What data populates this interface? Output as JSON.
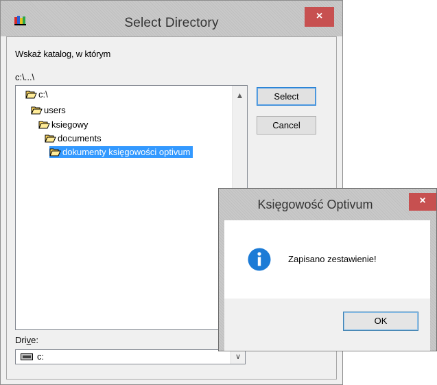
{
  "select_dialog": {
    "title": "Select Directory",
    "close_label": "×",
    "prompt": "Wskaż katalog, w którym",
    "current_path": "c:\\...\\",
    "tree": [
      {
        "label": "c:\\",
        "depth": 0,
        "selected": false,
        "icon": "open-folder-icon"
      },
      {
        "label": "users",
        "depth": 1,
        "selected": false,
        "icon": "open-folder-icon"
      },
      {
        "label": "ksiegowy",
        "depth": 2,
        "selected": false,
        "icon": "open-folder-icon"
      },
      {
        "label": "documents",
        "depth": 3,
        "selected": false,
        "icon": "open-folder-icon"
      },
      {
        "label": "dokumenty księgowości optivum",
        "depth": 4,
        "selected": true,
        "icon": "open-folder-icon"
      }
    ],
    "select_button": "Select",
    "cancel_button": "Cancel",
    "drive_label_underlined": "v",
    "drive_label_prefix": "Dri",
    "drive_label_suffix": "e:",
    "drive_value": "c:"
  },
  "message_box": {
    "title": "Księgowość Optivum",
    "close_label": "×",
    "message": "Zapisano zestawienie!",
    "ok_button": "OK",
    "icon": "info-icon"
  },
  "colors": {
    "selection": "#3399ff",
    "close_button": "#c75050",
    "info_icon": "#1c7bd6"
  }
}
